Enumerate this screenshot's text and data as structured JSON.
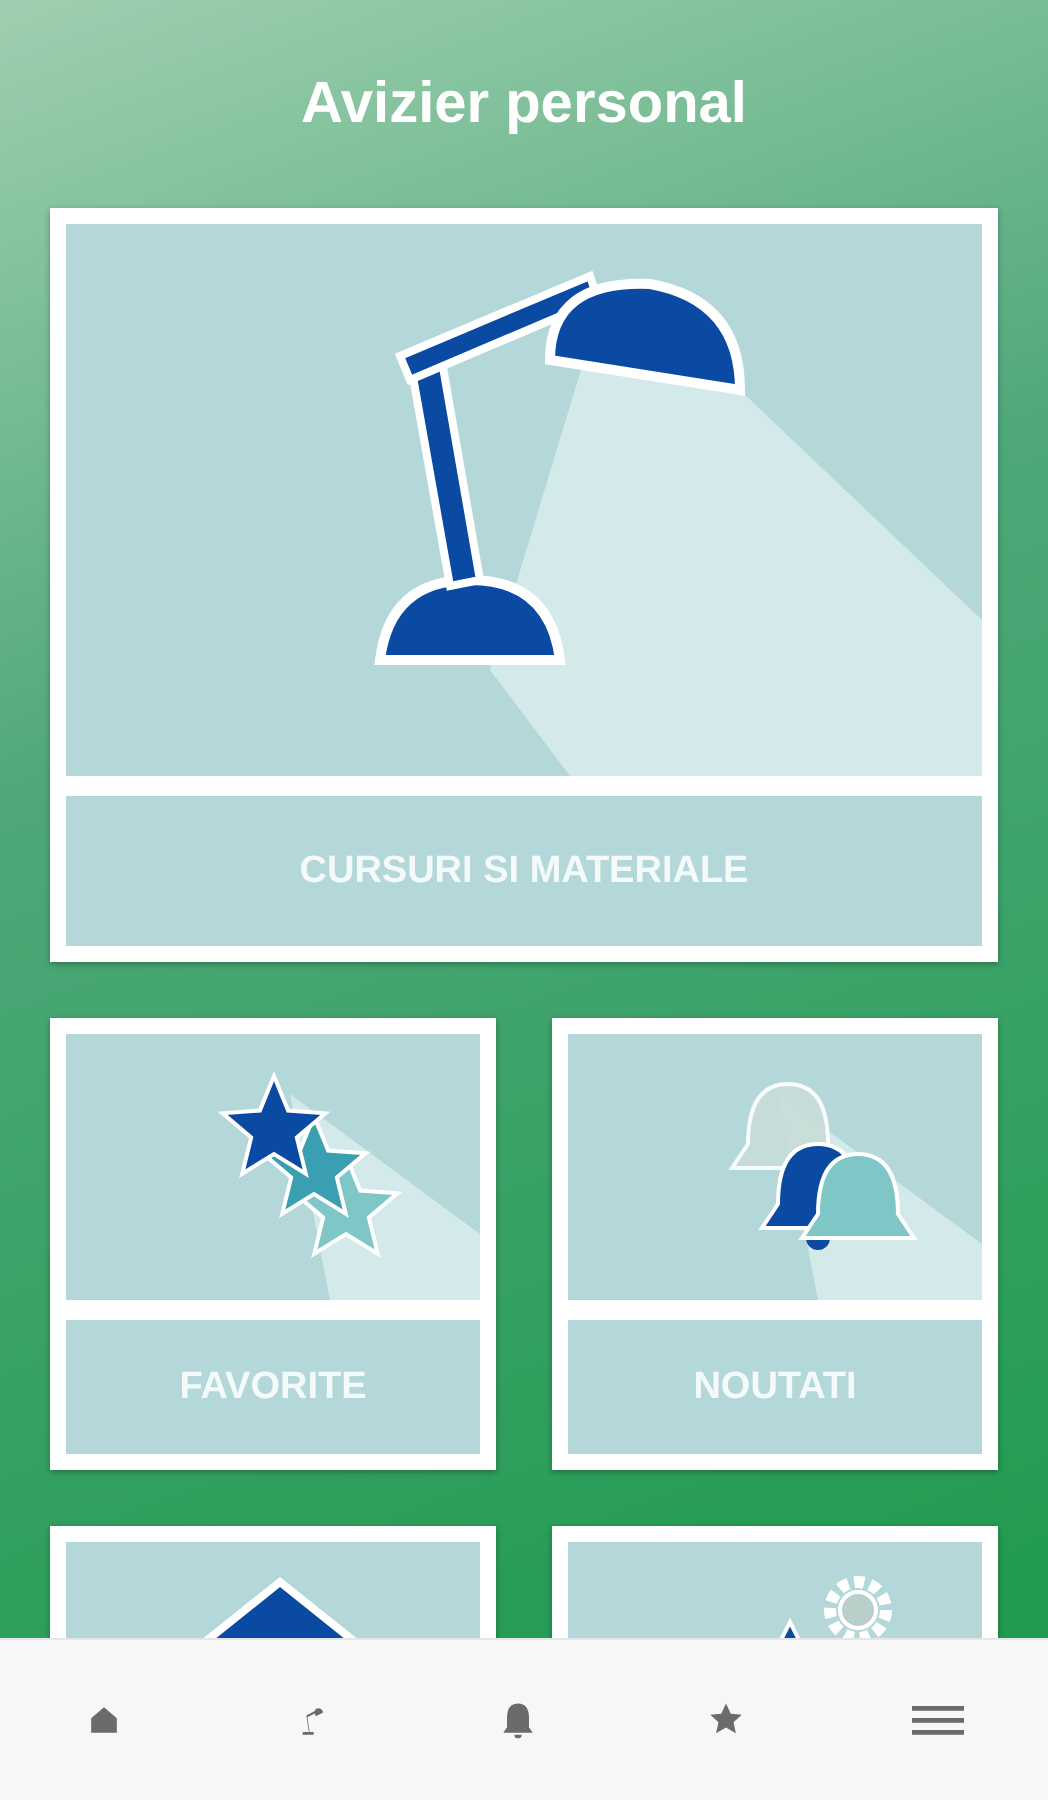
{
  "title": "Avizier personal",
  "tiles": [
    {
      "kind": "lamp",
      "label": "CURSURI SI MATERIALE"
    },
    {
      "kind": "stars",
      "label": "FAVORITE"
    },
    {
      "kind": "bells",
      "label": "NOUTATI"
    },
    {
      "kind": "house"
    },
    {
      "kind": "gear"
    }
  ],
  "nav": [
    {
      "kind": "home"
    },
    {
      "kind": "lamp"
    },
    {
      "kind": "bell"
    },
    {
      "kind": "star"
    },
    {
      "kind": "menu"
    }
  ]
}
